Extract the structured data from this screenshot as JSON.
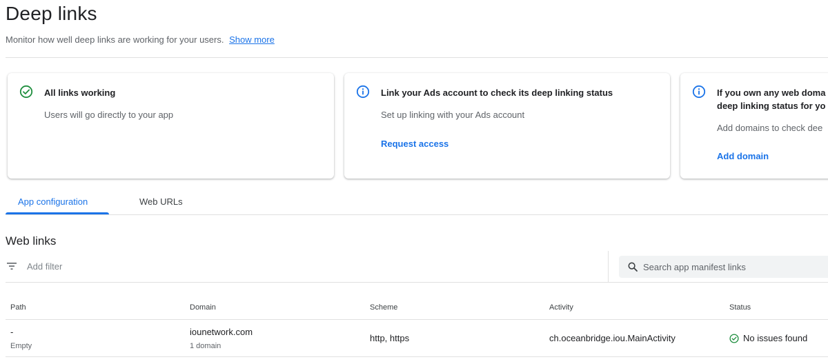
{
  "header": {
    "title": "Deep links",
    "subtitle": "Monitor how well deep links are working for your users.",
    "show_more": "Show more"
  },
  "cards": [
    {
      "icon": "check-circle-icon",
      "title": "All links working",
      "description": "Users will go directly to your app"
    },
    {
      "icon": "info-icon",
      "title": "Link your Ads account to check its deep linking status",
      "description": "Set up linking with your Ads account",
      "action": "Request access"
    },
    {
      "icon": "info-icon",
      "title_line1": "If you own any web doma",
      "title_line2": "deep linking status for yo",
      "description": "Add domains to check dee",
      "action": "Add domain"
    }
  ],
  "tabs": [
    {
      "label": "App configuration",
      "active": true
    },
    {
      "label": "Web URLs",
      "active": false
    }
  ],
  "web_links": {
    "title": "Web links",
    "filter_placeholder": "Add filter",
    "search_placeholder": "Search app manifest links",
    "columns": [
      "Path",
      "Domain",
      "Scheme",
      "Activity",
      "Status"
    ],
    "rows": [
      {
        "path": "-",
        "path_sub": "Empty",
        "domain": "iounetwork.com",
        "domain_sub": "1 domain",
        "scheme": "http, https",
        "activity": "ch.oceanbridge.iou.MainActivity",
        "status": "No issues found"
      }
    ]
  },
  "colors": {
    "accent": "#1a73e8",
    "success": "#1e8e3e",
    "text_secondary": "#5f6368"
  }
}
